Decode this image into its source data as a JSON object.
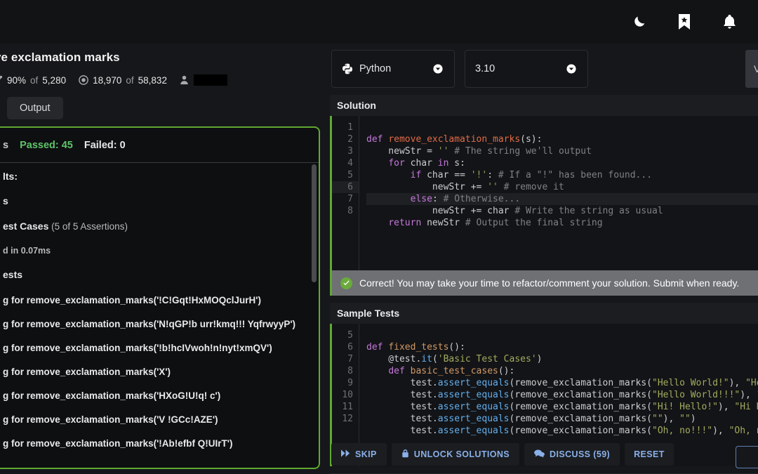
{
  "header": {
    "icons": [
      {
        "name": "dark-mode-icon",
        "label": "moon"
      },
      {
        "name": "bookmark-icon",
        "label": "bookmark-star"
      },
      {
        "name": "notifications-icon",
        "label": "bell"
      }
    ]
  },
  "kata": {
    "title": "ve exclamation marks",
    "stats": {
      "completion_pct": "90%",
      "completion_of": "of",
      "completion_total": "5,280",
      "satisfaction": "18,970",
      "satisfaction_of": "of",
      "satisfaction_total": "58,832",
      "username_redacted": ""
    },
    "output_tab": "Output"
  },
  "results": {
    "time_label": "s",
    "passed_label": "Passed: 45",
    "failed_label": "Failed: 0",
    "lines": [
      {
        "text": "lts:",
        "kind": "bold"
      },
      {
        "text": "s",
        "kind": "bold"
      },
      {
        "text": "est Cases",
        "suffix": " (5 of 5 Assertions)",
        "kind": "group"
      },
      {
        "text": "d in 0.07ms",
        "kind": "dim"
      },
      {
        "text": "ests",
        "kind": "bold"
      }
    ],
    "logs": [
      "g for remove_exclamation_marks('!C!Gqt!HxMOQclJurH')",
      "g for remove_exclamation_marks('N!qGP!b urr!kmq!!! YqfrwyyP')",
      "g for remove_exclamation_marks('!b!hcIVwoh!n!nyt!xmQV')",
      "g for remove_exclamation_marks('X')",
      "g for remove_exclamation_marks('HXoG!U!q! c')",
      "g for remove_exclamation_marks('V !GCc!AZE')",
      "g for remove_exclamation_marks('!Ab!efbf  Q!UIrT')"
    ]
  },
  "selectors": {
    "language": "Python",
    "version": "3.10",
    "view_button": "V"
  },
  "solution": {
    "panel_title": "Solution",
    "line_numbers": [
      "1",
      "2",
      "3",
      "4",
      "5",
      "6",
      "7",
      "8"
    ],
    "highlighted_line": 6,
    "code": [
      "def remove_exclamation_marks(s):",
      "    newStr = '' # The string we'll output",
      "    for char in s:",
      "        if char == '!': # If a \"!\" has been found...",
      "            newStr += '' # remove it",
      "        else: # Otherwise...",
      "            newStr += char # Write the string as usual",
      "    return newStr # Output the final string"
    ]
  },
  "status": {
    "message": "Correct! You may take your time to refactor/comment your solution. Submit when ready."
  },
  "sample_tests": {
    "panel_title": "Sample Tests",
    "line_numbers": [
      "5",
      "6",
      "7",
      "8",
      "9",
      "10",
      "11",
      "12"
    ],
    "code": [
      "def fixed_tests():",
      "    @test.it('Basic Test Cases')",
      "    def basic_test_cases():",
      "        test.assert_equals(remove_exclamation_marks(\"Hello World!\"), \"Hello",
      "        test.assert_equals(remove_exclamation_marks(\"Hello World!!!\"), \"Hel",
      "        test.assert_equals(remove_exclamation_marks(\"Hi! Hello!\"), \"Hi Hell",
      "        test.assert_equals(remove_exclamation_marks(\"\"), \"\")",
      "        test.assert_equals(remove_exclamation_marks(\"Oh, no!!!\"), \"Oh, no\")"
    ]
  },
  "actions": {
    "skip": "SKIP",
    "unlock_solutions": "UNLOCK SOLUTIONS",
    "discuss": "DISCUSS (59)",
    "reset": "RESET"
  },
  "colors": {
    "accent_green": "#5fa832",
    "pass_green": "#5fc36a",
    "link_blue": "#8ab0e8",
    "background": "#16171a"
  }
}
